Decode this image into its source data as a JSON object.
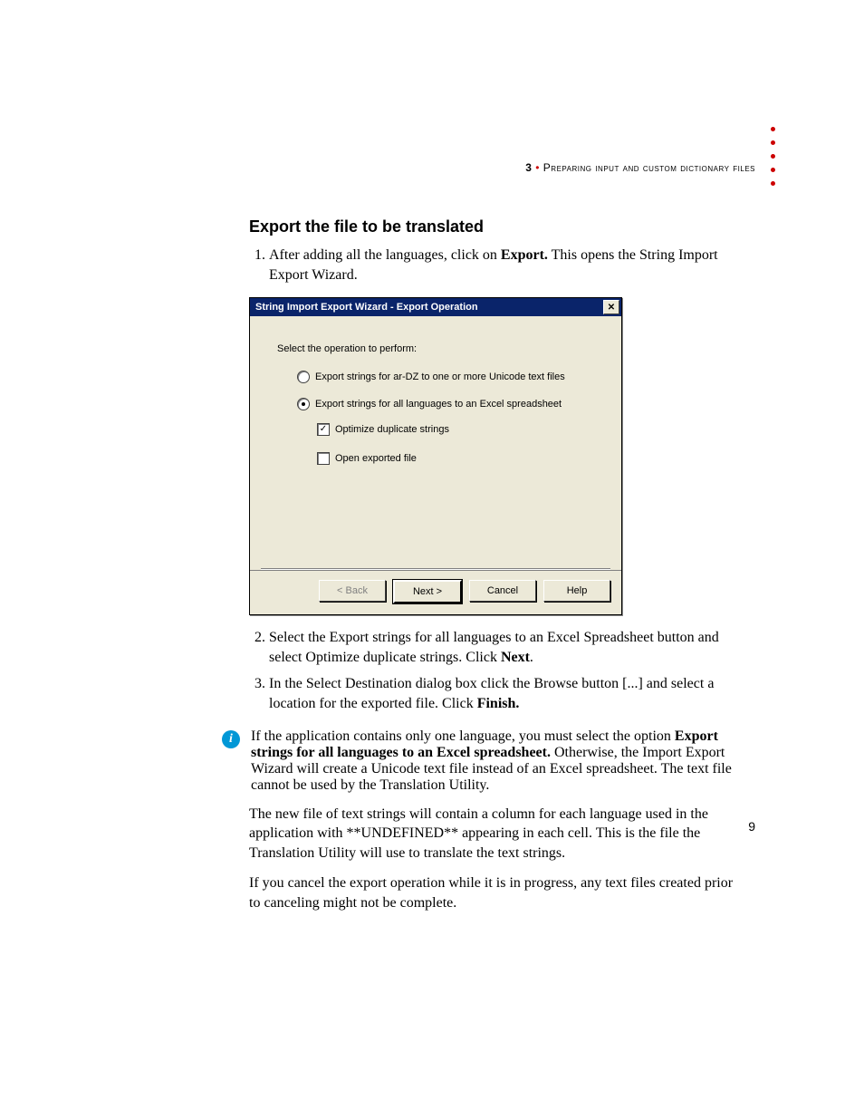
{
  "header": {
    "chapter_number": "3",
    "bullet": "•",
    "chapter_title": "Preparing input and custom dictionary files"
  },
  "section_title": "Export the file to be translated",
  "steps_a": [
    {
      "pre": "After adding all the languages, click on ",
      "bold": "Export.",
      "post": " This opens the String Import Export Wizard."
    }
  ],
  "dialog": {
    "title": "String Import Export Wizard - Export Operation",
    "close": "✕",
    "prompt": "Select the operation to perform:",
    "radio1": "Export strings for ar-DZ to one or more Unicode text files",
    "radio2": "Export strings for all languages to an Excel spreadsheet",
    "check1": "Optimize duplicate strings",
    "check1_checked": "✓",
    "check2": "Open exported file",
    "buttons": {
      "back": "< Back",
      "next": "Next >",
      "cancel": "Cancel",
      "help": "Help"
    }
  },
  "steps_b": [
    {
      "pre": "Select the Export strings for all languages to an Excel Spreadsheet button and select Optimize duplicate strings. Click ",
      "bold": "Next",
      "post": "."
    },
    {
      "pre": "In the Select Destination dialog box click the Browse button [...] and select a location for the exported file. Click ",
      "bold": "Finish.",
      "post": ""
    }
  ],
  "info": {
    "pre": "If the application contains only one language, you must select the option ",
    "bold": "Export strings for all languages to an Excel spreadsheet.",
    "post": " Otherwise, the Import Export Wizard will create a Unicode text file instead of an Excel spreadsheet. The text file cannot be used by the Translation Utility."
  },
  "para1": "The new file of text strings will contain a column for each language used in the application with **UNDEFINED** appearing in each cell. This is the file the Translation Utility will use to translate the text strings.",
  "para2": "If you cancel the export operation while it is in progress, any text files created prior to canceling might not be complete.",
  "page_number": "9",
  "info_icon_glyph": "i"
}
